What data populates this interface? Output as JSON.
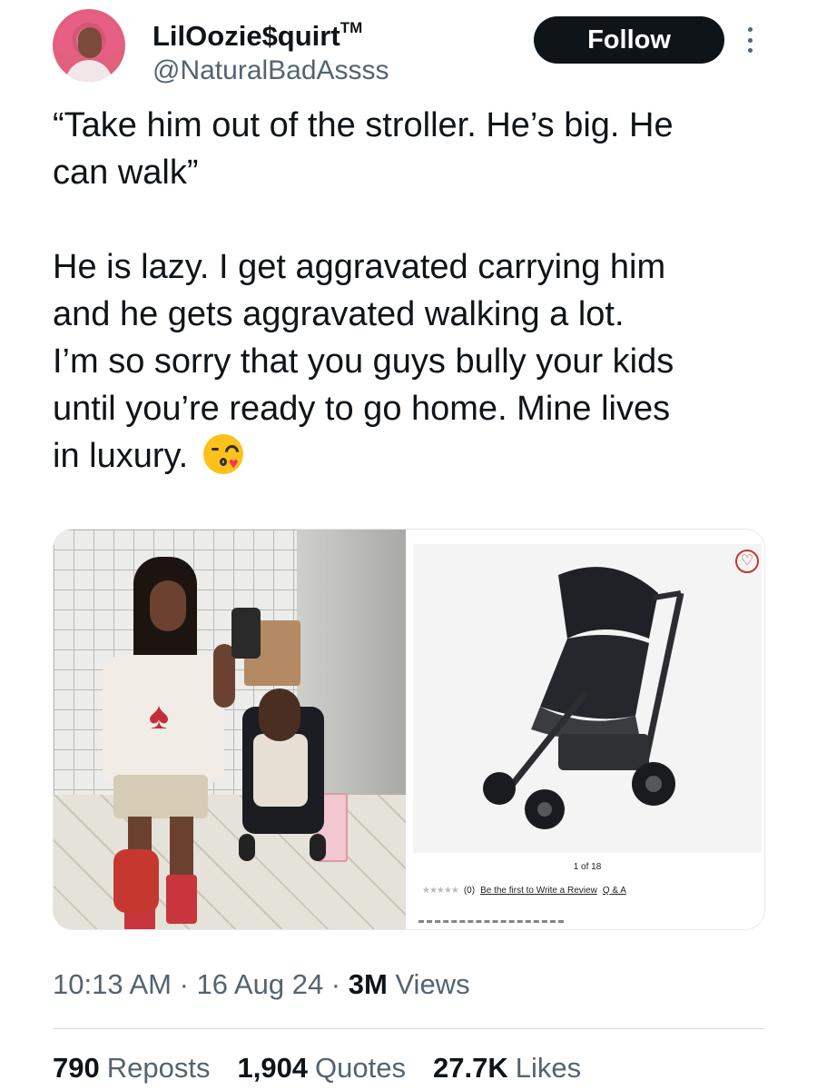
{
  "author": {
    "display_name": "LilOozie$quirt",
    "trademark": "TM",
    "handle": "@NaturalBadAssss",
    "avatar_icon": "user-avatar"
  },
  "actions": {
    "follow_label": "Follow",
    "more_icon": "more-vertical-icon"
  },
  "tweet": {
    "lines_p1": [
      "“Take him out of the stroller. He’s big. He",
      "can walk”"
    ],
    "lines_p2": [
      "He is lazy. I get aggravated carrying him",
      "and he gets aggravated walking a lot.",
      "I’m so sorry that you guys bully your kids",
      "until you’re ready to go home. Mine lives",
      "in luxury."
    ],
    "emoji": "kissing-face-with-heart-emoji"
  },
  "media": {
    "right": {
      "pager": "1 of 18",
      "stars": "★★★★★",
      "review_count": "(0)",
      "review_link": "Be the first to Write a Review",
      "qa_link": "Q & A",
      "heart_icon": "heart-outline-icon"
    }
  },
  "meta": {
    "time": "10:13 AM",
    "sep1": " · ",
    "date": "16 Aug 24",
    "sep2": " · ",
    "views_count": "3M",
    "views_label": " Views"
  },
  "stats": {
    "reposts_count": "790",
    "reposts_label": "Reposts",
    "quotes_count": "1,904",
    "quotes_label": "Quotes",
    "likes_count": "27.7K",
    "likes_label": "Likes"
  }
}
